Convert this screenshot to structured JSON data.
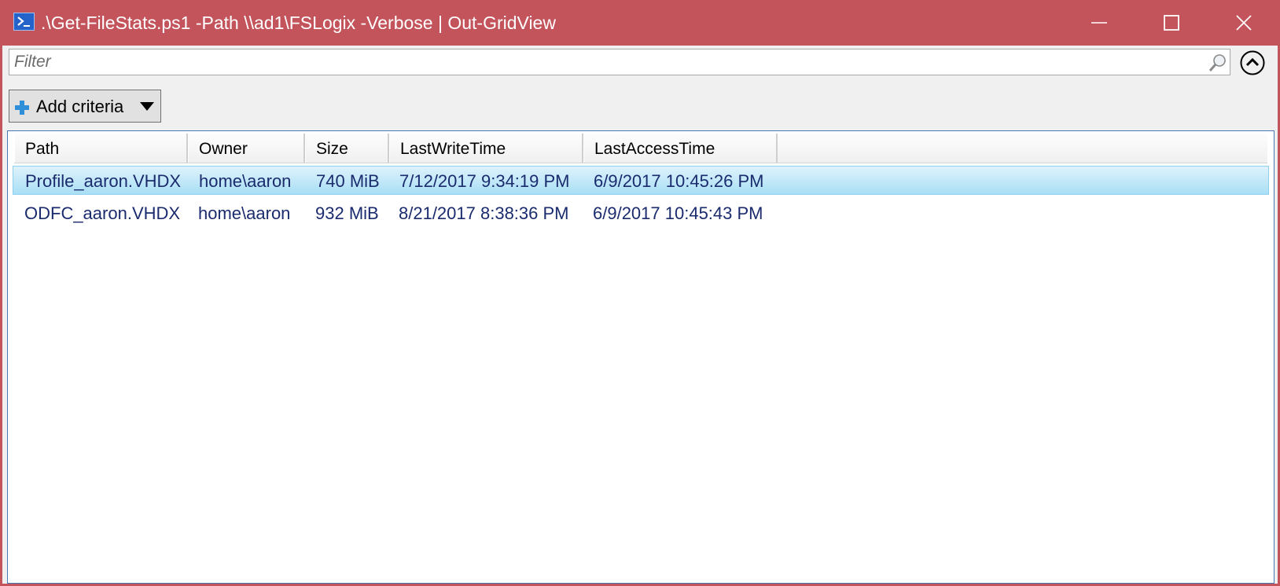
{
  "window": {
    "title": ".\\Get-FileStats.ps1 -Path \\\\ad1\\FSLogix -Verbose | Out-GridView",
    "titlebar_color": "#c4545c"
  },
  "filter": {
    "placeholder": "Filter",
    "value": ""
  },
  "criteria": {
    "add_label": "Add criteria"
  },
  "grid": {
    "columns": [
      "Path",
      "Owner",
      "Size",
      "LastWriteTime",
      "LastAccessTime"
    ],
    "rows": [
      {
        "path": "Profile_aaron.VHDX",
        "owner": "home\\aaron",
        "size": "740 MiB",
        "last_write": "7/12/2017 9:34:19 PM",
        "last_access": "6/9/2017 10:45:26 PM",
        "selected": true
      },
      {
        "path": "ODFC_aaron.VHDX",
        "owner": "home\\aaron",
        "size": "932 MiB",
        "last_write": "8/21/2017 8:38:36 PM",
        "last_access": "6/9/2017 10:45:43 PM",
        "selected": false
      }
    ]
  }
}
